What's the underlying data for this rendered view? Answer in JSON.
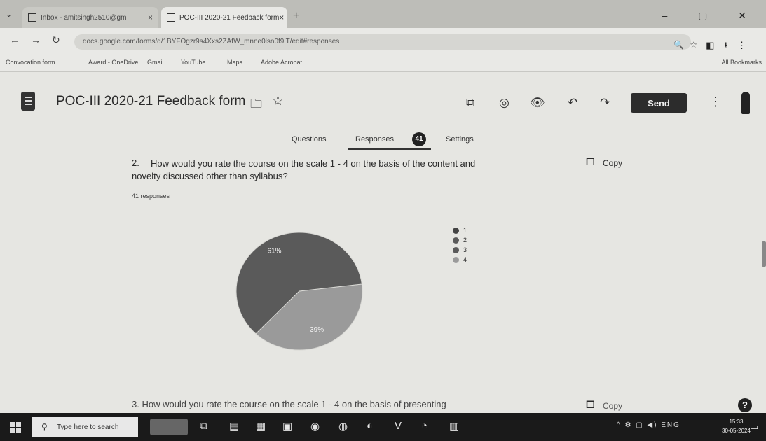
{
  "browser": {
    "tab_menu_icon": "chevron-down-icon",
    "tabs": [
      {
        "title": "Inbox - amitsingh2510@gm"
      },
      {
        "title": "POC-III 2020-21 Feedback form"
      }
    ],
    "new_tab_glyph": "+",
    "window_controls": "–  ▢  ✕",
    "address": "docs.google.com/forms/d/1BYFOgzr9s4Xxs2ZAfW_mnne0lsn0f9iT/edit#responses",
    "bookmarks": [
      "Convocation form",
      "Award - OneDrive",
      "Gmail",
      "YouTube",
      "Maps",
      "Adobe Acrobat"
    ],
    "all_bookmarks_label": "All Bookmarks"
  },
  "forms": {
    "title": "POC-III 2020-21 Feedback form",
    "send_label": "Send",
    "tabs": {
      "questions": "Questions",
      "responses": "Responses",
      "responses_count": "41",
      "settings": "Settings"
    }
  },
  "question": {
    "number": "2.",
    "text_line1": "How would you rate the course on the scale 1 - 4 on the basis of the content and",
    "text_line2": "novelty discussed other than syllabus?",
    "responses_label": "41 responses",
    "copy_label": "Copy"
  },
  "chart_data": {
    "type": "pie",
    "title": "",
    "slices": [
      {
        "label": "1",
        "value": 0,
        "color": "#444444"
      },
      {
        "label": "2",
        "value": 0,
        "color": "#5a5a5a"
      },
      {
        "label": "3",
        "value": 61,
        "color": "#5a5a5a",
        "display": "61%"
      },
      {
        "label": "4",
        "value": 39,
        "color": "#9a9a9a",
        "display": "39%"
      }
    ],
    "legend_position": "right"
  },
  "next_question": {
    "text": "3.   How would you rate the course on the scale 1 - 4 on the basis of presenting",
    "copy_label": "Copy"
  },
  "taskbar": {
    "search_placeholder": "Type here to search",
    "tray_text": "^ ⚙ ▢ ◀) ENG",
    "time": "15:33",
    "date": "30-05-2024"
  }
}
